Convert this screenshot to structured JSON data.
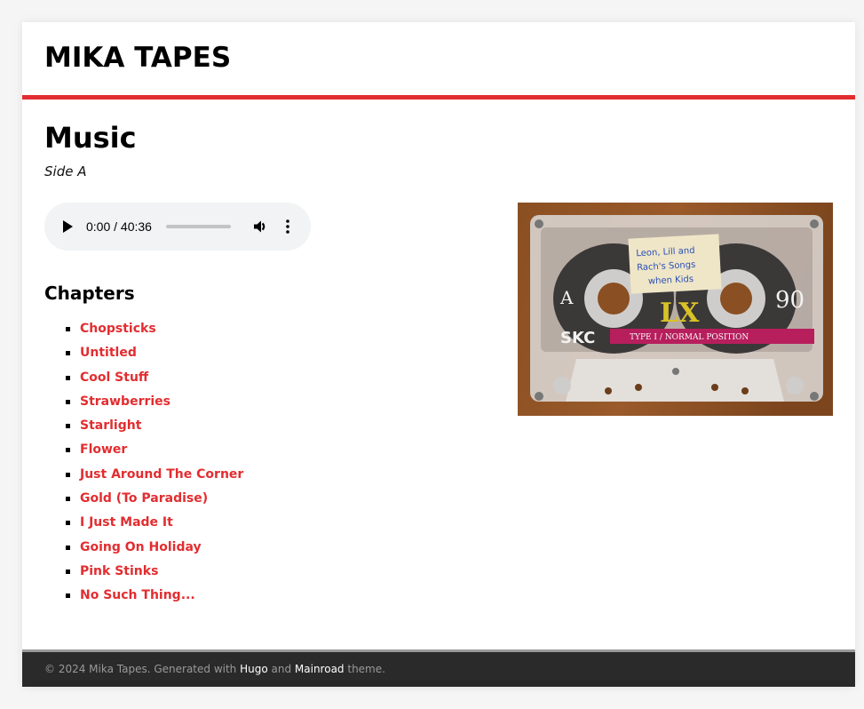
{
  "site": {
    "title": "MIKA TAPES",
    "accent_color": "#e22d30"
  },
  "page": {
    "title": "Music",
    "subtitle": "Side A"
  },
  "player": {
    "current_time": "0:00",
    "duration": "40:36",
    "time_display": "0:00 / 40:36",
    "progress_percent": 0,
    "play_icon": "play-icon",
    "volume_icon": "volume-icon",
    "more_icon": "more-options-icon"
  },
  "chapters": {
    "heading": "Chapters",
    "items": [
      {
        "label": "Chopsticks"
      },
      {
        "label": "Untitled"
      },
      {
        "label": "Cool Stuff"
      },
      {
        "label": "Strawberries"
      },
      {
        "label": "Starlight"
      },
      {
        "label": "Flower"
      },
      {
        "label": "Just Around The Corner"
      },
      {
        "label": "Gold (To Paradise)"
      },
      {
        "label": "I Just Made It"
      },
      {
        "label": "Going On Holiday"
      },
      {
        "label": "Pink Stinks"
      },
      {
        "label": "No Such Thing..."
      }
    ]
  },
  "cover": {
    "label_line1": "Leon, Lill and",
    "label_line2": "Rach's Songs",
    "label_line3": "when Kids",
    "side": "A",
    "length": "90",
    "model": "LX",
    "brand": "SKC",
    "type_text": "TYPE I / NORMAL POSITION"
  },
  "footer": {
    "prefix": "© 2024 Mika Tapes. Generated with ",
    "hugo_link": "Hugo",
    "middle": " and ",
    "mainroad_link": "Mainroad",
    "suffix": " theme."
  }
}
